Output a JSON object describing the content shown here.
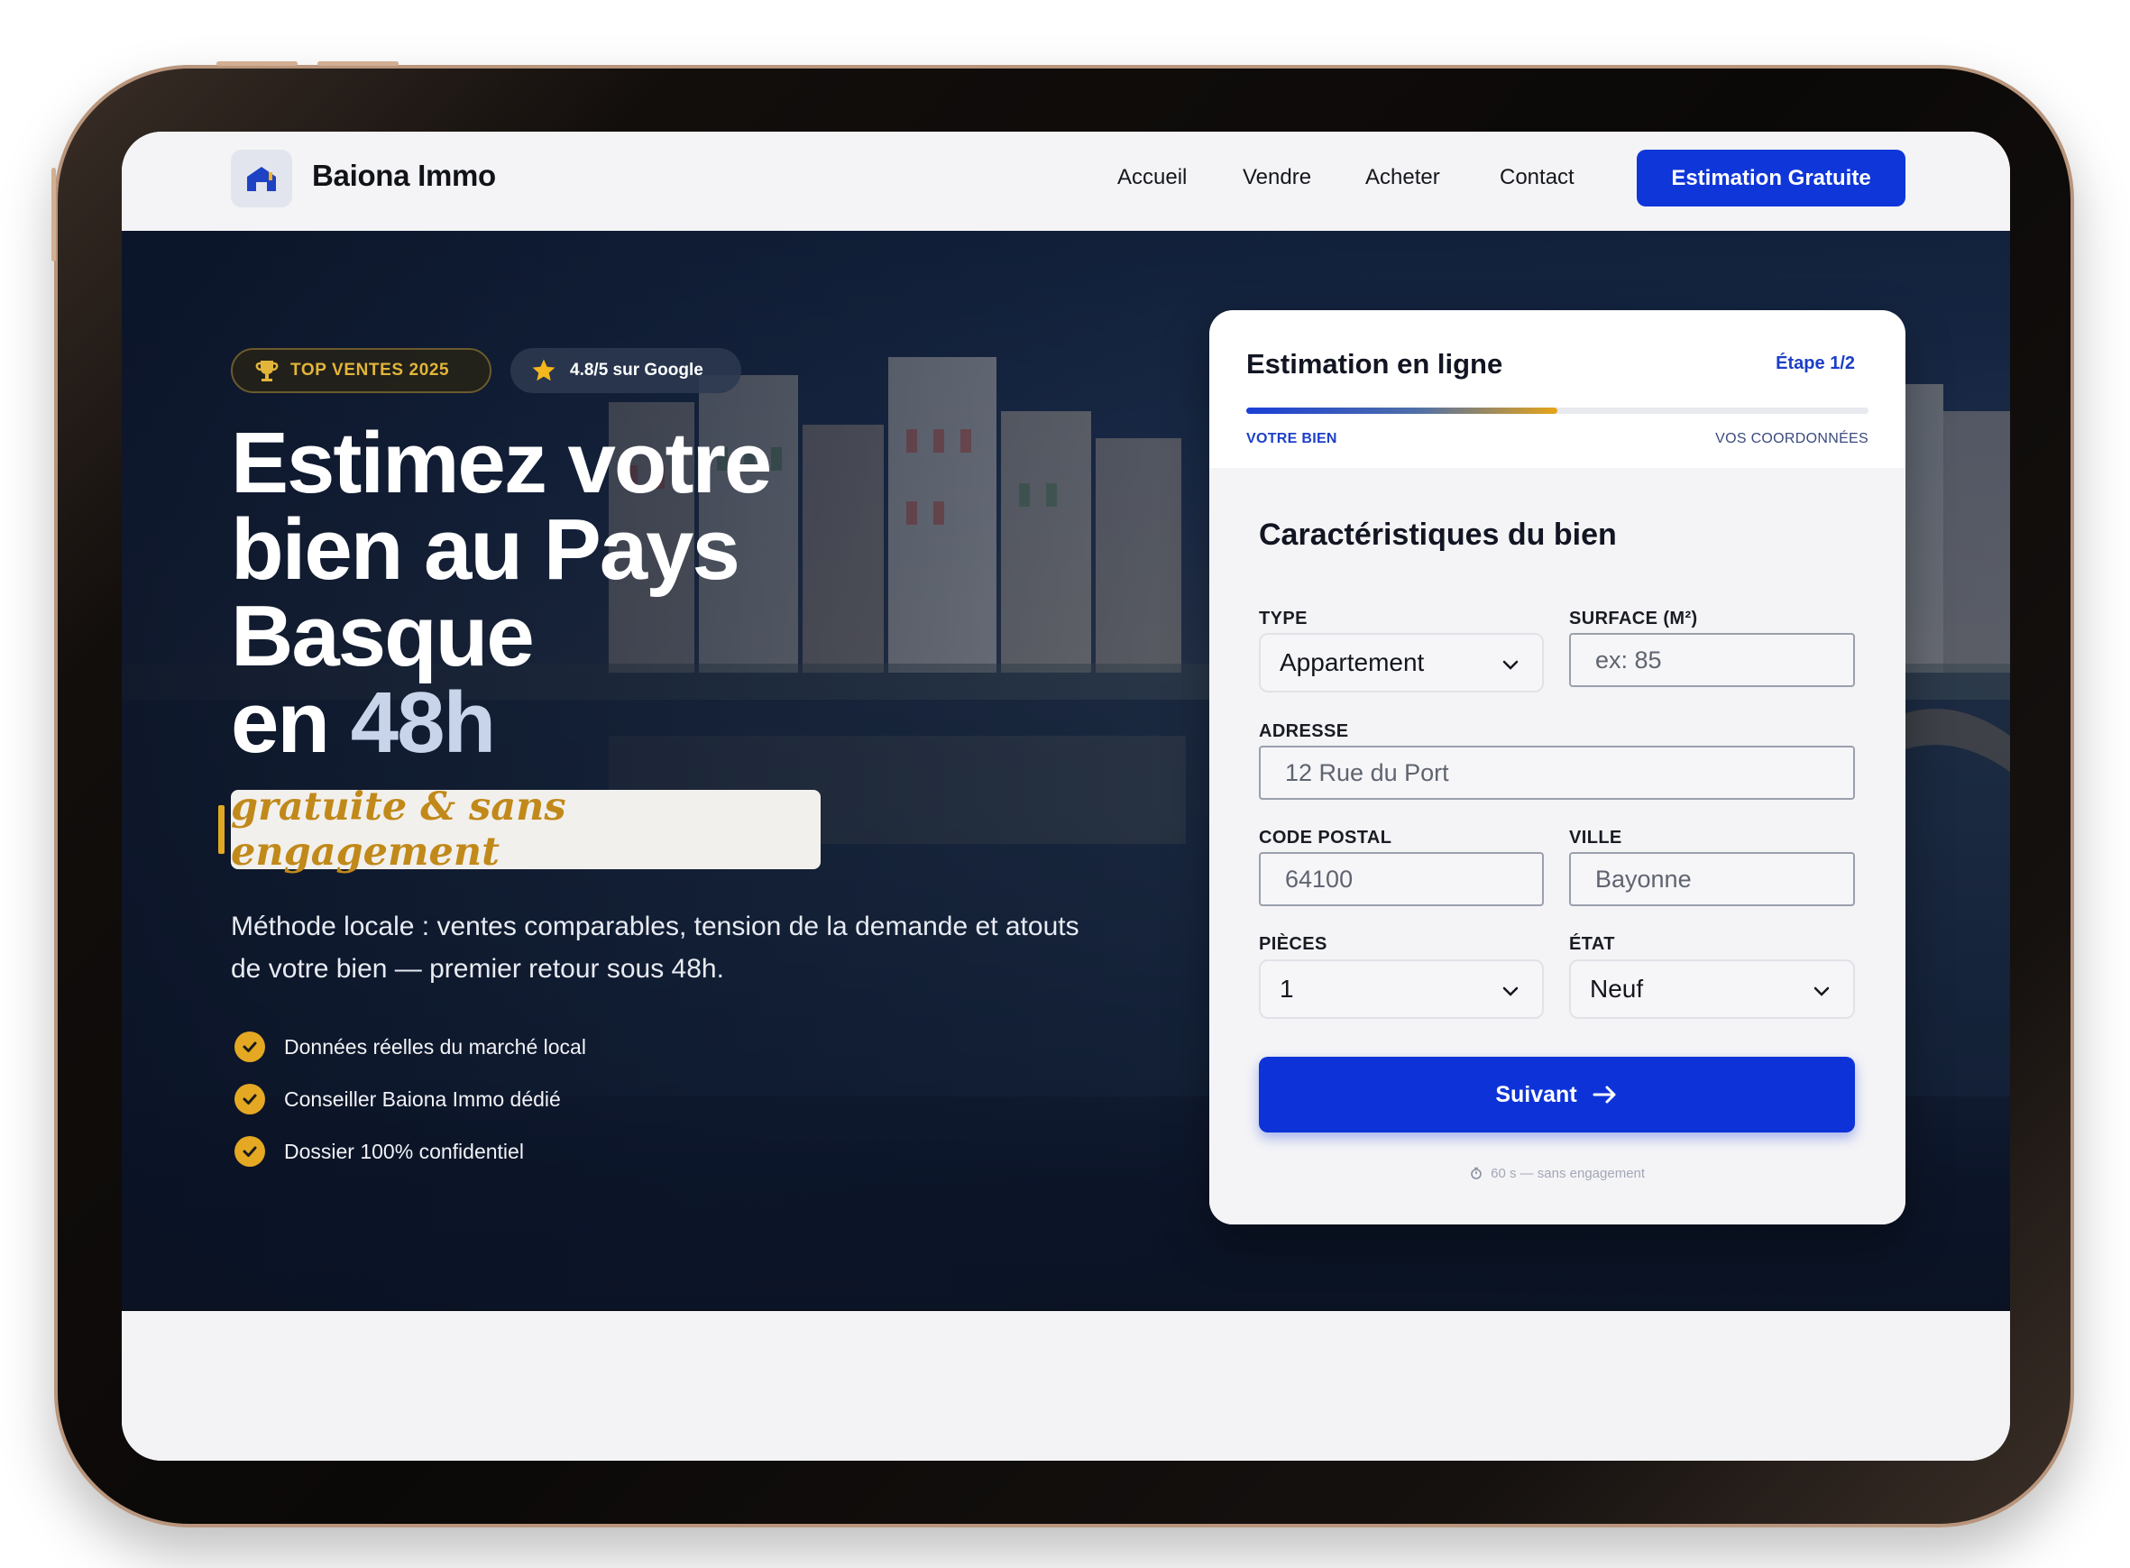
{
  "brand": {
    "name": "Baiona Immo",
    "icon": "house-icon"
  },
  "nav": {
    "links": [
      "Accueil",
      "Vendre",
      "Acheter",
      "Contact"
    ],
    "cta": "Estimation Gratuite"
  },
  "hero": {
    "badge_top": "TOP VENTES 2025",
    "badge_google": "4.8/5 sur Google",
    "headline_lines": [
      "Estimez votre",
      "bien au Pays",
      "Basque"
    ],
    "headline_last_prefix": "en ",
    "headline_accent": "48h",
    "script": "gratuite & sans engagement",
    "subtext": "Méthode locale : ventes comparables, tension de la demande et atouts de votre bien — premier retour sous 48h.",
    "checks": [
      "Données réelles du marché local",
      "Conseiller Baiona Immo dédié",
      "Dossier 100% confidentiel"
    ]
  },
  "form": {
    "title": "Estimation en ligne",
    "step": "Étape 1/2",
    "progress": 0.5,
    "step_left": "VOTRE BIEN",
    "step_right": "VOS COORDONNÉES",
    "section_title": "Caractéristiques du bien",
    "type_label": "TYPE",
    "type_value": "Appartement",
    "surface_label": "SURFACE (M²)",
    "surface_placeholder": "ex: 85",
    "address_label": "ADRESSE",
    "address_placeholder": "12 Rue du Port",
    "postal_label": "CODE POSTAL",
    "postal_placeholder": "64100",
    "city_label": "VILLE",
    "city_placeholder": "Bayonne",
    "rooms_label": "PIÈCES",
    "rooms_value": "1",
    "state_label": "ÉTAT",
    "state_value": "Neuf",
    "submit": "Suivant",
    "footnote": "60 s — sans engagement"
  },
  "colors": {
    "primary": "#0f36d9",
    "accent": "#e4a823",
    "dark": "#111319"
  }
}
